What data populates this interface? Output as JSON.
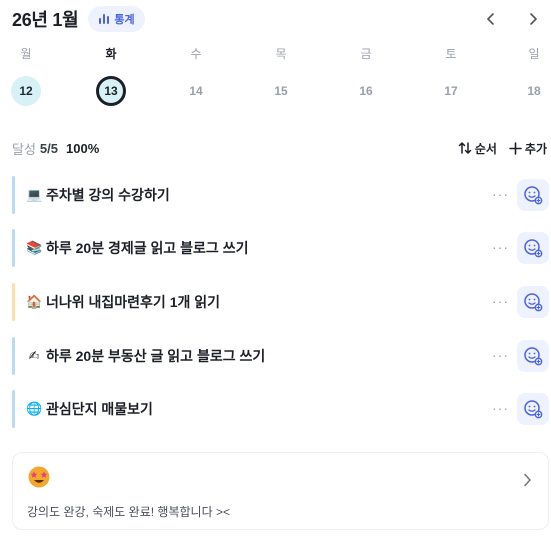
{
  "header": {
    "month": "26년 1월",
    "stats_label": "통계",
    "prev_icon": "chevron-left-icon",
    "next_icon": "chevron-right-icon"
  },
  "week": {
    "days": [
      {
        "dow": "월",
        "date": "12",
        "state": "done"
      },
      {
        "dow": "화",
        "date": "13",
        "state": "today"
      },
      {
        "dow": "수",
        "date": "14",
        "state": "none"
      },
      {
        "dow": "목",
        "date": "15",
        "state": "none"
      },
      {
        "dow": "금",
        "date": "16",
        "state": "none"
      },
      {
        "dow": "토",
        "date": "17",
        "state": "none"
      },
      {
        "dow": "일",
        "date": "18",
        "state": "none"
      }
    ]
  },
  "progress": {
    "label": "달성",
    "count": "5/5",
    "percent": "100%",
    "value": 1.0,
    "sort_label": "순서",
    "add_label": "추가"
  },
  "todos": [
    {
      "emoji": "💻",
      "title": "주차별 강의 수강하기",
      "bar_color": "#b9dbf3"
    },
    {
      "emoji": "📚",
      "title": "하루 20분 경제글 읽고 블로그 쓰기",
      "bar_color": "#b9dbf3"
    },
    {
      "emoji": "🏠",
      "title": "너나위 내집마련후기 1개 읽기",
      "bar_color": "#fde0a8"
    },
    {
      "emoji": "✍",
      "title": "하루 20분 부동산 글 읽고 블로그 쓰기",
      "bar_color": "#b9dbf3"
    },
    {
      "emoji": "🌐",
      "title": "관심단지 매물보기",
      "bar_color": "#b9dbf3"
    }
  ],
  "comment": {
    "emoji": "🤩",
    "text": "강의도 완강, 숙제도 완료! 행복합니다 ><"
  },
  "colors": {
    "accent": "#4a63e0",
    "accent_bg": "#eef2ff",
    "done_day_bg": "#d8f1f7"
  }
}
